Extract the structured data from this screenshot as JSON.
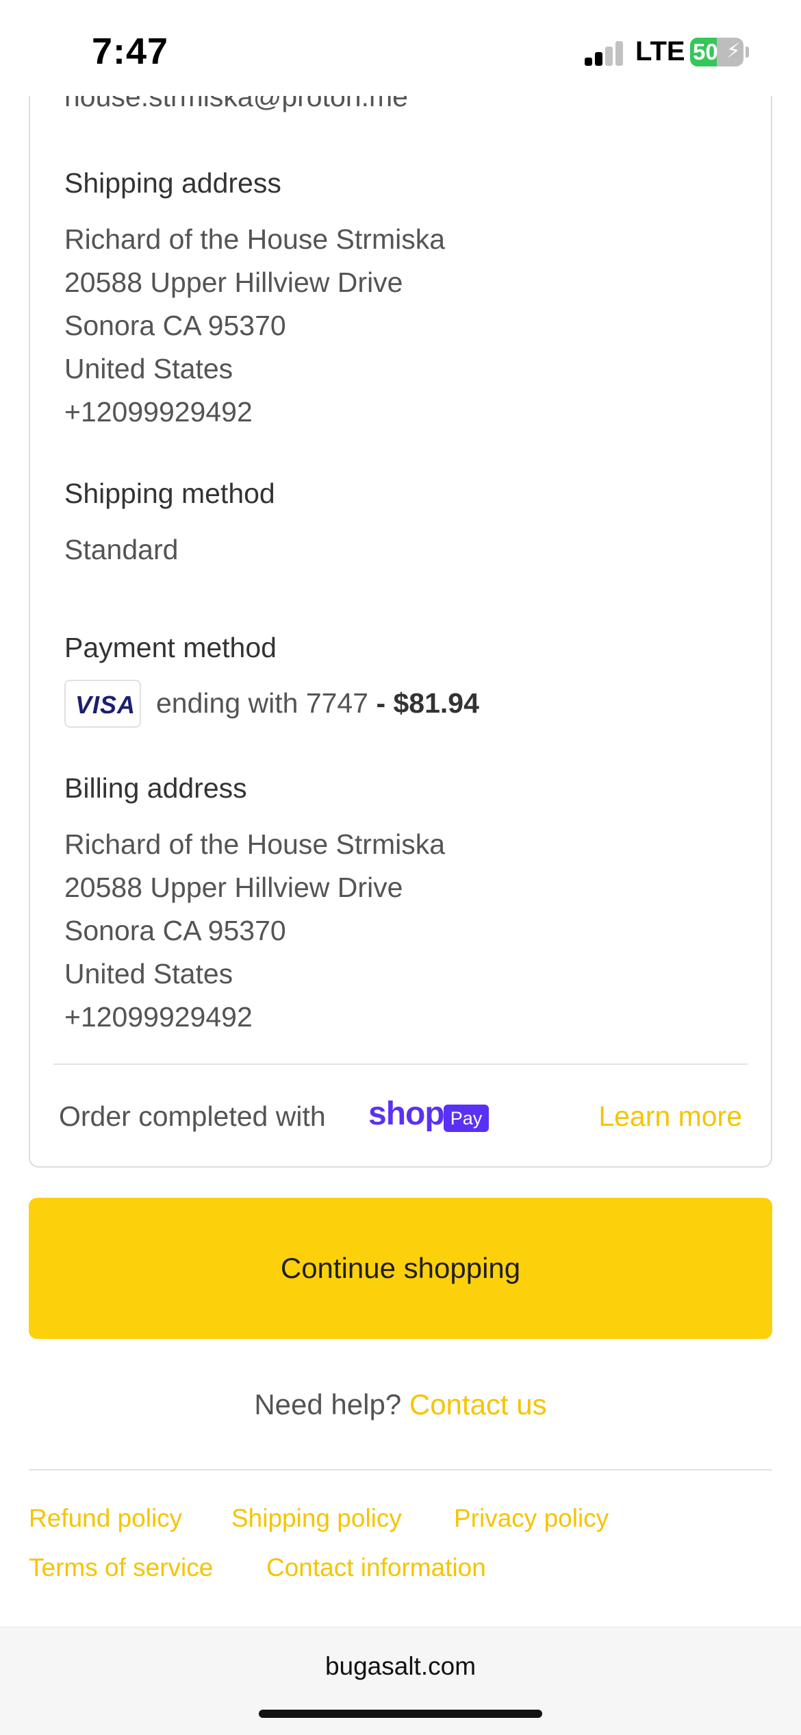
{
  "status_bar": {
    "time": "7:47",
    "network": "LTE",
    "battery_level": 50,
    "battery_label": "50",
    "charging": true,
    "signal_bars_active": 2,
    "signal_bars_total": 4
  },
  "order": {
    "email": "house.strmiska@proton.me",
    "shipping_address": {
      "title": "Shipping address",
      "lines": [
        "Richard of the House Strmiska",
        "20588 Upper Hillview Drive",
        "Sonora CA 95370",
        "United States",
        "+12099929492"
      ]
    },
    "shipping_method": {
      "title": "Shipping method",
      "value": "Standard"
    },
    "payment_method": {
      "title": "Payment method",
      "card_brand": "VISA",
      "ending_text": "ending with 7747",
      "amount_text": "- $81.94"
    },
    "billing_address": {
      "title": "Billing address",
      "lines": [
        "Richard of the House Strmiska",
        "20588 Upper Hillview Drive",
        "Sonora CA 95370",
        "United States",
        "+12099929492"
      ]
    },
    "completed_with": "Order completed with",
    "shop_logo": "shop",
    "pay_badge": "Pay",
    "learn_more": "Learn more"
  },
  "actions": {
    "continue_shopping": "Continue shopping"
  },
  "help": {
    "question": "Need help?",
    "contact": "Contact us"
  },
  "footer": {
    "links": [
      "Refund policy",
      "Shipping policy",
      "Privacy policy",
      "Terms of service",
      "Contact information"
    ]
  },
  "browser": {
    "domain": "bugasalt.com"
  },
  "colors": {
    "accent": "#fdd00c",
    "link": "#f5c400",
    "shop_pay": "#5a31f4",
    "visa": "#1a1f71"
  }
}
